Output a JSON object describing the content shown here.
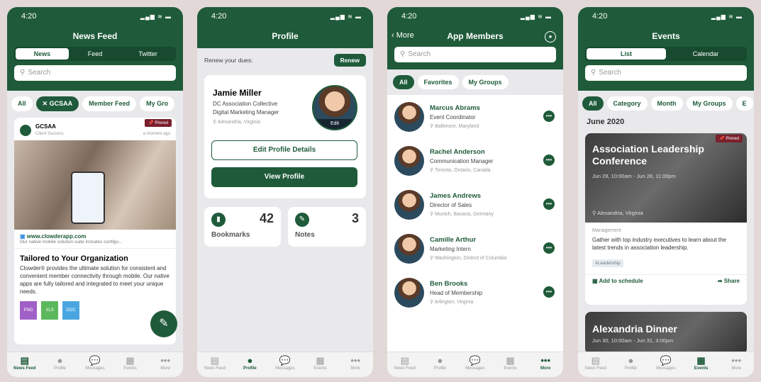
{
  "status_time": "4:20",
  "tabs": [
    "News Feed",
    "Profile",
    "Messages",
    "Events",
    "More"
  ],
  "feed": {
    "title": "News Feed",
    "segments": [
      "News",
      "Feed",
      "Twitter"
    ],
    "search_placeholder": "Search",
    "chips": [
      "All",
      "GCSAA",
      "Member Feed",
      "My Gro"
    ],
    "post": {
      "org": "GCSAA",
      "sub": "Client Success",
      "time": "a moment ago",
      "pinned": "Pinned",
      "link": "www.clowderapp.com",
      "link_desc": "Our native mobile solution suite includes configu...",
      "heading": "Tailored to Your Organization",
      "body": "Clowder® provides the ultimate solution for consistent and convenient member connectivity through mobile. Our native apps are fully tailored and integrated to meet your unique needs.",
      "files": [
        "PNG",
        "XLS",
        "DOC"
      ]
    }
  },
  "profile": {
    "title": "Profile",
    "renew_text": "Renew your dues:",
    "renew_btn": "Renew",
    "name": "Jamie Miller",
    "org": "DC Association Collective",
    "role": "Digital Marketing Manager",
    "loc": "Alexandria, Virginia",
    "edit": "Edit",
    "edit_btn": "Edit Profile Details",
    "view_btn": "View Profile",
    "bookmarks_label": "Bookmarks",
    "bookmarks_count": "42",
    "notes_label": "Notes",
    "notes_count": "3"
  },
  "members": {
    "back": "More",
    "title": "App Members",
    "search_placeholder": "Search",
    "chips": [
      "All",
      "Favorites",
      "My Groups"
    ],
    "list": [
      {
        "name": "Marcus Abrams",
        "role": "Event Coordinator",
        "loc": "Baltimore, Maryland"
      },
      {
        "name": "Rachel Anderson",
        "role": "Communication Manager",
        "loc": "Toronto, Ontario, Canada"
      },
      {
        "name": "James Andrews",
        "role": "Director of Sales",
        "loc": "Munich, Bavaria, Germany"
      },
      {
        "name": "Camille Arthur",
        "role": "Marketing Intern",
        "loc": "Washington, District of Columbia"
      },
      {
        "name": "Ben Brooks",
        "role": "Head of Membership",
        "loc": "Arlington, Virginia"
      }
    ]
  },
  "events": {
    "title": "Events",
    "segments": [
      "List",
      "Calendar"
    ],
    "search_placeholder": "Search",
    "chips": [
      "All",
      "Category",
      "Month",
      "My Groups",
      "E"
    ],
    "month": "June 2020",
    "e1": {
      "pinned": "Pinned",
      "title": "Association Leadership Conference",
      "date": "Jun 28, 10:00am - Jun 28, 11:00pm",
      "loc": "Alexandria, Virginia",
      "cat": "Management",
      "desc": "Gather with top industry executives to learn about the latest trends in association leadership.",
      "tag": "#Leadership",
      "add": "Add to schedule",
      "share": "Share"
    },
    "e2": {
      "title": "Alexandria Dinner",
      "date": "Jun 30, 10:00am - Jun 31, 3:00pm"
    }
  }
}
